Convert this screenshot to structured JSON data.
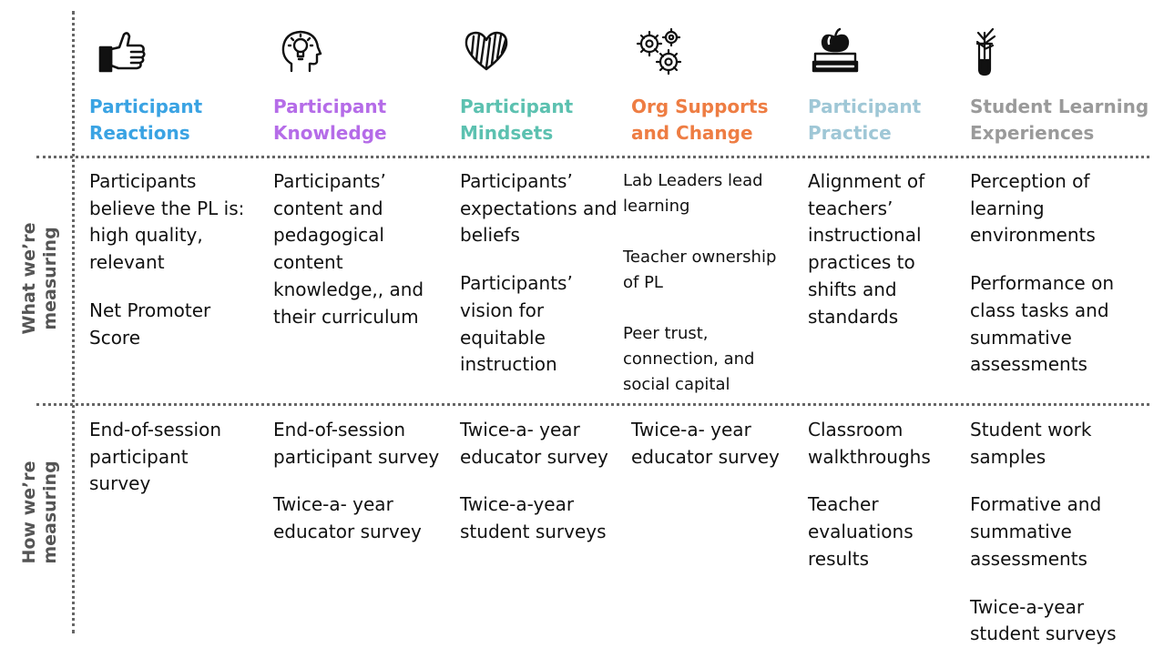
{
  "row_labels": {
    "what": "What we’re measuring",
    "how": "How we’re measuring"
  },
  "columns": [
    {
      "icon": "thumbs-up-icon",
      "header": "Participant Reactions",
      "color": "#3aa3e3",
      "what": [
        "Participants believe the PL is: high quality, relevant",
        "Net Promoter Score"
      ],
      "how": [
        "End-of-session participant survey"
      ]
    },
    {
      "icon": "head-lightbulb-icon",
      "header": "Participant Knowledge",
      "color": "#b56ce8",
      "what": [
        "Participants’ content and pedagogical content knowledge,, and their curriculum"
      ],
      "how": [
        "End-of-session participant survey",
        "Twice-a- year educator survey"
      ]
    },
    {
      "icon": "heart-icon",
      "header": "Participant Mindsets",
      "color": "#5cc1b0",
      "what": [
        "Participants’ expectations and beliefs",
        "Participants’ vision for equitable instruction"
      ],
      "how": [
        "Twice-a- year educator survey",
        "Twice-a-year student surveys"
      ]
    },
    {
      "icon": "gears-icon",
      "header": "Org Supports and Change",
      "color": "#ee7d43",
      "what": [
        "Lab Leaders lead learning",
        "Teacher ownership of PL",
        "Peer trust, connection, and social capital"
      ],
      "how": [
        "Twice-a- year educator survey"
      ]
    },
    {
      "icon": "apple-books-icon",
      "header": "Participant Practice",
      "color": "#9fc7d6",
      "what": [
        "Alignment of teachers’ instructional practices to shifts and standards"
      ],
      "how": [
        "Classroom walkthroughs",
        "Teacher evaluations results"
      ]
    },
    {
      "icon": "plant-test-tube-icon",
      "header": "Student Learning Experiences",
      "color": "#9a9a9a",
      "what": [
        "Perception of learning environments",
        "Performance on class tasks and summative assessments"
      ],
      "how": [
        "Student work samples",
        "Formative and summative assessments",
        "Twice-a-year student surveys"
      ]
    }
  ]
}
